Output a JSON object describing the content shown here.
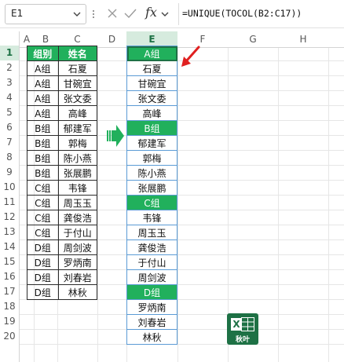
{
  "name_box": {
    "value": "E1",
    "dropdown_icon": "chevron-down-icon"
  },
  "formula_bar": {
    "more_icon": "vertical-dots-icon",
    "cancel_icon": "x-icon",
    "enter_icon": "check-icon",
    "fx_label": "fx",
    "fx_dropdown_icon": "chevron-down-icon",
    "formula": "=UNIQUE(TOCOL(B2:C17))"
  },
  "columns": [
    "A",
    "B",
    "C",
    "D",
    "E",
    "F",
    "G",
    "H"
  ],
  "selected_column": "E",
  "rows": [
    "1",
    "2",
    "3",
    "4",
    "5",
    "6",
    "7",
    "8",
    "9",
    "10",
    "11",
    "12",
    "13",
    "14",
    "15",
    "16",
    "17",
    "18",
    "19",
    "20"
  ],
  "selected_row": "1",
  "source_table": {
    "headers": [
      "组别",
      "姓名"
    ],
    "rows": [
      [
        "A组",
        "石夏"
      ],
      [
        "A组",
        "甘碗宜"
      ],
      [
        "A组",
        "张文委"
      ],
      [
        "A组",
        "高峰"
      ],
      [
        "B组",
        "郁建军"
      ],
      [
        "B组",
        "郭梅"
      ],
      [
        "B组",
        "陈小燕"
      ],
      [
        "B组",
        "张展鹏"
      ],
      [
        "C组",
        "韦锋"
      ],
      [
        "C组",
        "周玉玉"
      ],
      [
        "C组",
        "龚俊浩"
      ],
      [
        "C组",
        "于付山"
      ],
      [
        "D组",
        "周剑波"
      ],
      [
        "D组",
        "罗炳南"
      ],
      [
        "D组",
        "刘春岩"
      ],
      [
        "D组",
        "林秋"
      ]
    ]
  },
  "result_column": [
    "A组",
    "石夏",
    "甘碗宜",
    "张文委",
    "高峰",
    "B组",
    "郁建军",
    "郭梅",
    "陈小燕",
    "张展鹏",
    "C组",
    "韦锋",
    "周玉玉",
    "龚俊浩",
    "于付山",
    "周剑波",
    "D组",
    "罗炳南",
    "刘春岩",
    "林秋"
  ],
  "group_labels": [
    "A组",
    "B组",
    "C组",
    "D组"
  ],
  "colors": {
    "header_green": "#21b05c",
    "excel_green": "#1e7145",
    "selection_tint": "#d6ebde",
    "spill_border": "#5b9bd5",
    "arrow_green": "#21b05c",
    "arrow_red": "#e02020"
  },
  "logo": {
    "icon": "excel-logo-icon",
    "letter": "X",
    "caption": "秋叶"
  }
}
